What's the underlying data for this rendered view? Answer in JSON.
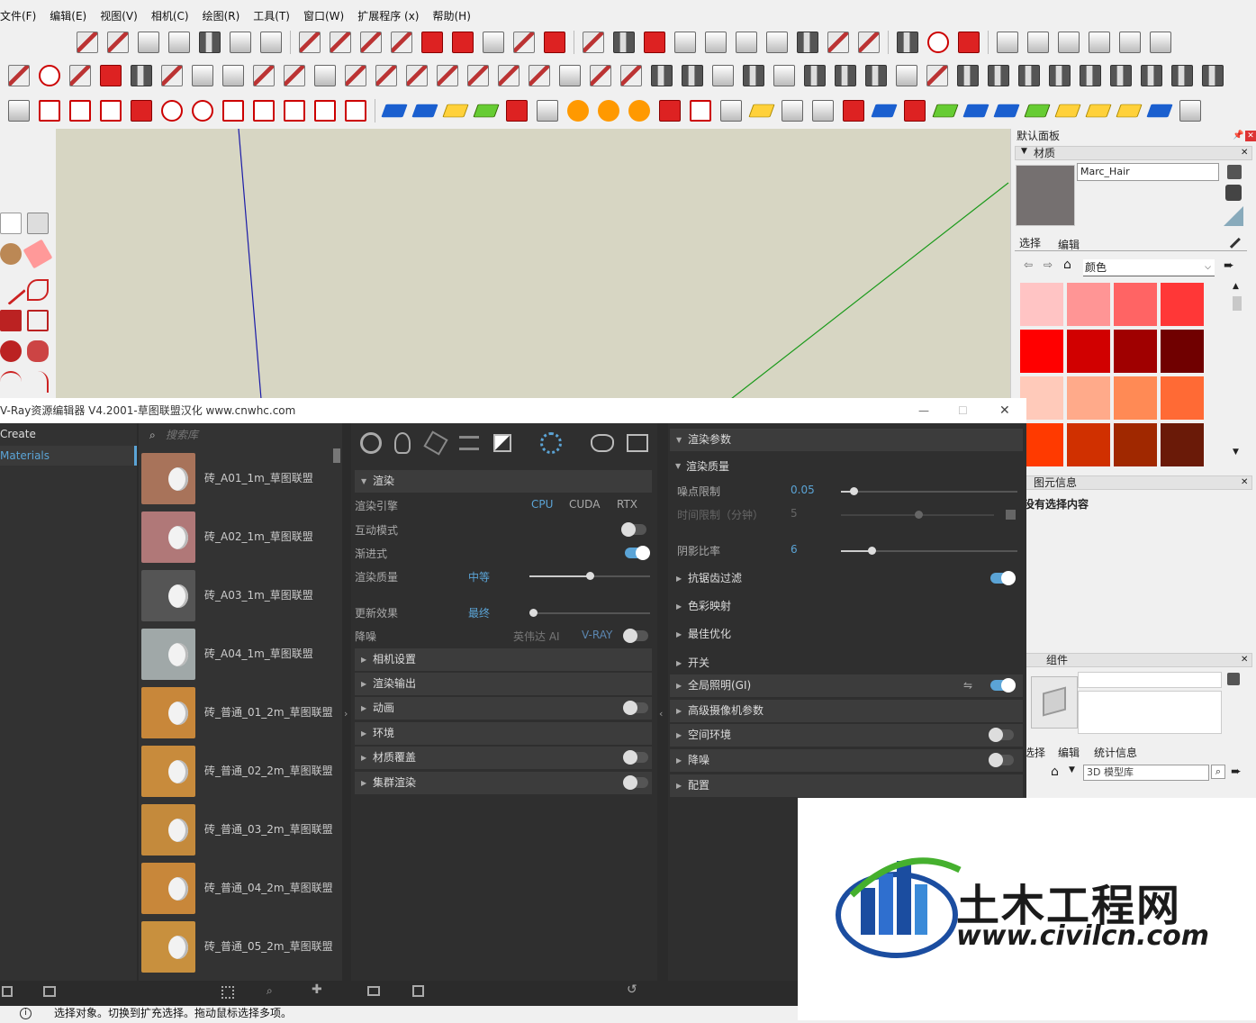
{
  "menu": [
    "文件(F)",
    "编辑(E)",
    "视图(V)",
    "相机(C)",
    "绘图(R)",
    "工具(T)",
    "窗口(W)",
    "扩展程序 (x)",
    "帮助(H)"
  ],
  "tray": {
    "title": "默认面板",
    "materials_section": "材质",
    "material_name": "Marc_Hair",
    "tab_select": "选择",
    "tab_edit": "编辑",
    "library": "颜色",
    "swatch_colors": [
      "#ffc4c4",
      "#ff9595",
      "#ff6464",
      "#ff3737",
      "#ff0000",
      "#d10000",
      "#a00000",
      "#700000",
      "#ffcaba",
      "#ffaa8a",
      "#ff8a55",
      "#ff6a35",
      "#ff3a00",
      "#d03000",
      "#a02800",
      "#6a1a08"
    ],
    "entity_info_section": "图元信息",
    "entity_info_text": "没有选择内容",
    "components_section": "组件",
    "comp_tab_select": "选择",
    "comp_tab_edit": "编辑",
    "comp_tab_stats": "统计信息",
    "comp_library": "3D 模型库"
  },
  "vray": {
    "title": "V-Ray资源编辑器 V4.2001-草图联盟汉化 www.cnwhc.com",
    "left": {
      "create": "Create",
      "materials": "Materials"
    },
    "search_placeholder": "搜索库",
    "materials": [
      "砖_A01_1m_草图联盟",
      "砖_A02_1m_草图联盟",
      "砖_A03_1m_草图联盟",
      "砖_A04_1m_草图联盟",
      "砖_普通_01_2m_草图联盟",
      "砖_普通_02_2m_草图联盟",
      "砖_普通_03_2m_草图联盟",
      "砖_普通_04_2m_草图联盟",
      "砖_普通_05_2m_草图联盟"
    ],
    "material_thumb_colors": [
      "#a8735a",
      "#b07878",
      "#555555",
      "#a0a8a8",
      "#c8873a",
      "#c88b3c",
      "#c48a3c",
      "#c8873a",
      "#c8903e"
    ],
    "mid": {
      "render_section": "渲染",
      "engine_label": "渲染引擎",
      "engine_cpu": "CPU",
      "engine_cuda": "CUDA",
      "engine_rtx": "RTX",
      "interactive_label": "互动模式",
      "progressive_label": "渐进式",
      "quality_label": "渲染质量",
      "quality_value": "中等",
      "quality_level": 0.5,
      "update_label": "更新效果",
      "update_value": "最终",
      "denoise_label": "降噪",
      "denoise_nvidia": "英伟达 AI",
      "denoise_vray": "V-RAY",
      "sections": [
        "相机设置",
        "渲染输出",
        "动画",
        "环境",
        "材质覆盖",
        "集群渲染"
      ]
    },
    "right": {
      "render_params": "渲染参数",
      "render_quality": "渲染质量",
      "noise_label": "噪点限制",
      "noise_value": "0.05",
      "time_label": "时间限制（分钟）",
      "time_value": "5",
      "shade_label": "阴影比率",
      "shade_value": "6",
      "sections": [
        "抗锯齿过滤",
        "色彩映射",
        "最佳优化",
        "开关",
        "全局照明(GI)",
        "高级摄像机参数",
        "空间环境",
        "降噪",
        "配置"
      ]
    }
  },
  "status_text": "选择对象。切换到扩充选择。拖动鼠标选择多项。",
  "watermark": {
    "title": "土木工程网",
    "url": "www.civilcn.com"
  }
}
